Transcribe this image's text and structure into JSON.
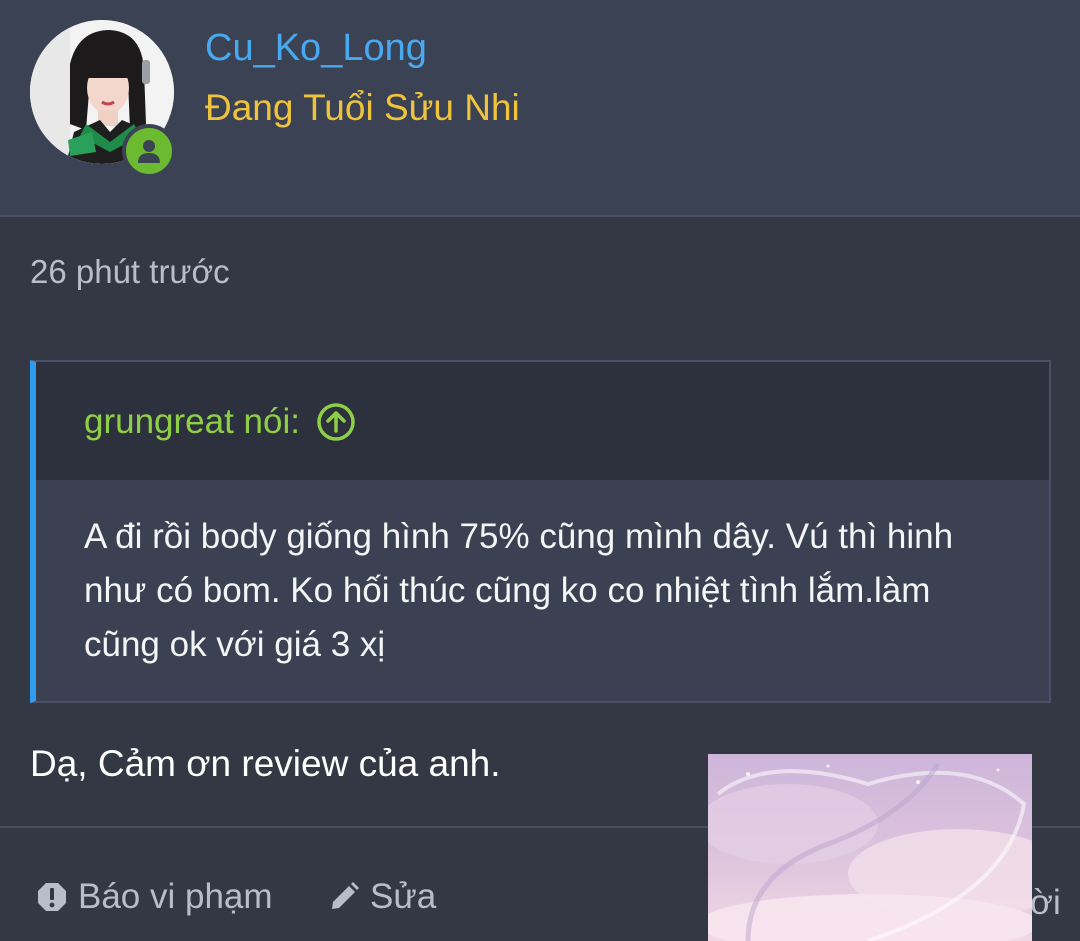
{
  "user": {
    "username": "Cu_Ko_Long",
    "title": "Đang Tuổi Sửu Nhi",
    "status": "online",
    "avatar_icon": "avatar-photo",
    "badge_icon": "user-online-icon"
  },
  "post": {
    "timestamp": "26 phút trước",
    "quote": {
      "author_label": "grungreat nói:",
      "jump_icon": "arrow-up-circle-icon",
      "text": "A đi rồi body giống hình 75% cũng mình dây. Vú thì hinh như có bom. Ko hối thúc cũng ko co nhiệt tình lắm.làm cũng ok với giá 3 xị"
    },
    "reply_text": "Dạ, Cảm ơn review của anh."
  },
  "actions": {
    "report_label": "Báo vi phạm",
    "report_icon": "exclamation-icon",
    "edit_label": "Sửa",
    "edit_icon": "pencil-icon",
    "more_label": "ời"
  },
  "colors": {
    "username": "#48a9ee",
    "title": "#efc33b",
    "quote_author": "#8fcf45",
    "quote_border": "#2f9cee",
    "online": "#6cba2f"
  }
}
